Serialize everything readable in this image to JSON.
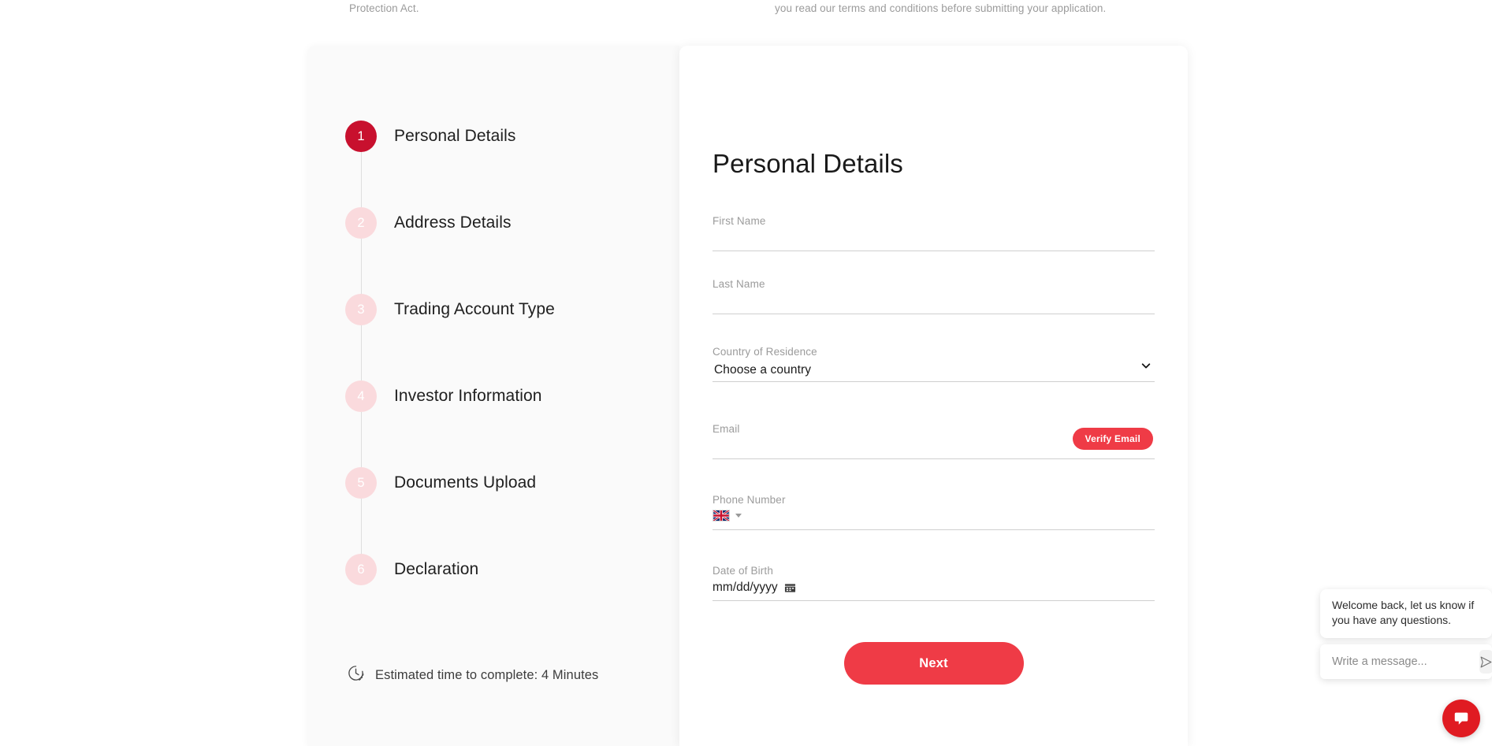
{
  "top_text": {
    "left_fragment": "Protection Act.",
    "right_fragment": "you read our terms and conditions before submitting your application."
  },
  "colors": {
    "brand_red": "#e01b22",
    "button_red": "#ef3b46",
    "active_step": "#c8102e",
    "idle_step": "#fadadd",
    "panel_bg": "#fafafa"
  },
  "stepper": {
    "steps": [
      {
        "number": "1",
        "label": "Personal Details",
        "state": "active"
      },
      {
        "number": "2",
        "label": "Address Details",
        "state": "idle"
      },
      {
        "number": "3",
        "label": "Trading Account Type",
        "state": "idle"
      },
      {
        "number": "4",
        "label": "Investor Information",
        "state": "idle"
      },
      {
        "number": "5",
        "label": "Documents Upload",
        "state": "idle"
      },
      {
        "number": "6",
        "label": "Declaration",
        "state": "idle"
      }
    ],
    "estimated_time": "Estimated time to complete: 4 Minutes",
    "clock_icon": "clock-icon"
  },
  "form": {
    "title": "Personal Details",
    "fields": {
      "first_name": {
        "label": "First Name",
        "value": "",
        "placeholder": ""
      },
      "last_name": {
        "label": "Last Name",
        "value": "",
        "placeholder": ""
      },
      "country": {
        "label": "Country of Residence",
        "value": "Choose a country",
        "chevron": "chevron-down-icon"
      },
      "email": {
        "label": "Email",
        "value": "",
        "placeholder": "",
        "verify_label": "Verify Email"
      },
      "phone": {
        "label": "Phone Number",
        "value": "",
        "flag": "uk-flag-icon",
        "caret": "caret-down-icon"
      },
      "dob": {
        "label": "Date of Birth",
        "value": "mm/dd/yyyy",
        "calendar_icon": "calendar-icon"
      }
    },
    "next_label": "Next"
  },
  "chat": {
    "message": "Welcome back, let us know if you have any questions.",
    "input_placeholder": "Write a message...",
    "input_value": "",
    "send_icon": "send-icon",
    "fab_icon": "chat-bubble-icon"
  }
}
